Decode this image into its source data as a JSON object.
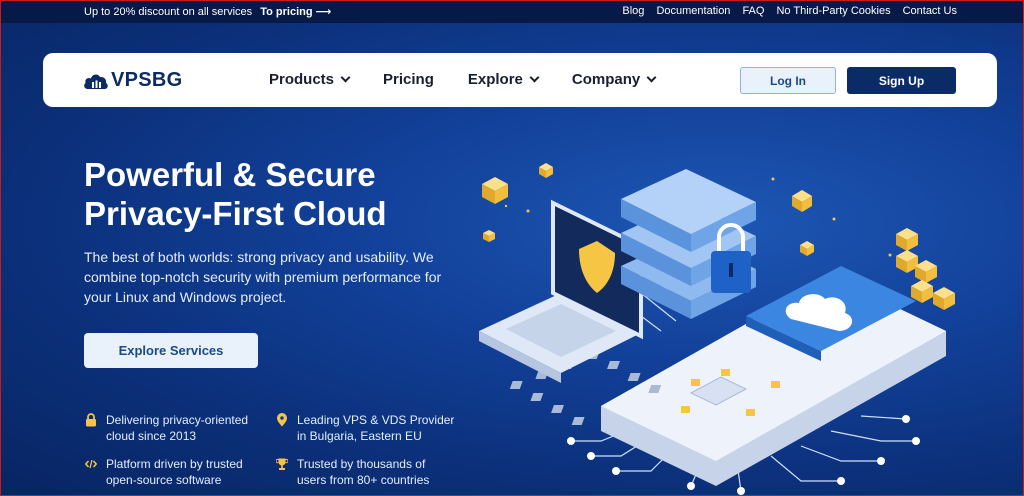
{
  "topbar": {
    "promo_text": "Up to 20% discount on all services",
    "promo_link": "To pricing ⟶",
    "links": [
      "Blog",
      "Documentation",
      "FAQ",
      "No Third-Party Cookies",
      "Contact Us"
    ]
  },
  "nav": {
    "logo": "VPSBG",
    "menu": [
      {
        "label": "Products",
        "dropdown": true
      },
      {
        "label": "Pricing",
        "dropdown": false
      },
      {
        "label": "Explore",
        "dropdown": true
      },
      {
        "label": "Company",
        "dropdown": true
      }
    ],
    "login_label": "Log In",
    "signup_label": "Sign Up"
  },
  "hero": {
    "title_line1": "Powerful & Secure",
    "title_line2": "Privacy-First Cloud",
    "subtitle": "The best of both worlds: strong privacy and usability. We combine top-notch security with premium performance for your Linux and Windows project.",
    "cta_label": "Explore Services"
  },
  "features": [
    {
      "icon": "lock-icon",
      "line1": "Delivering privacy-oriented",
      "line2": "cloud since 2013"
    },
    {
      "icon": "location-pin-icon",
      "line1": "Leading VPS & VDS Provider",
      "line2": "in Bulgaria, Eastern EU"
    },
    {
      "icon": "code-icon",
      "line1": "Platform driven by trusted",
      "line2": "open-source software"
    },
    {
      "icon": "trophy-icon",
      "line1": "Trusted by thousands of",
      "line2": "users from 80+ countries"
    }
  ],
  "colors": {
    "brand_dark": "#0b2b66",
    "topbar_bg": "#061a47",
    "hero_bg": "#12419a",
    "accent_yellow": "#f6c544",
    "button_light": "#e9f1fb"
  }
}
